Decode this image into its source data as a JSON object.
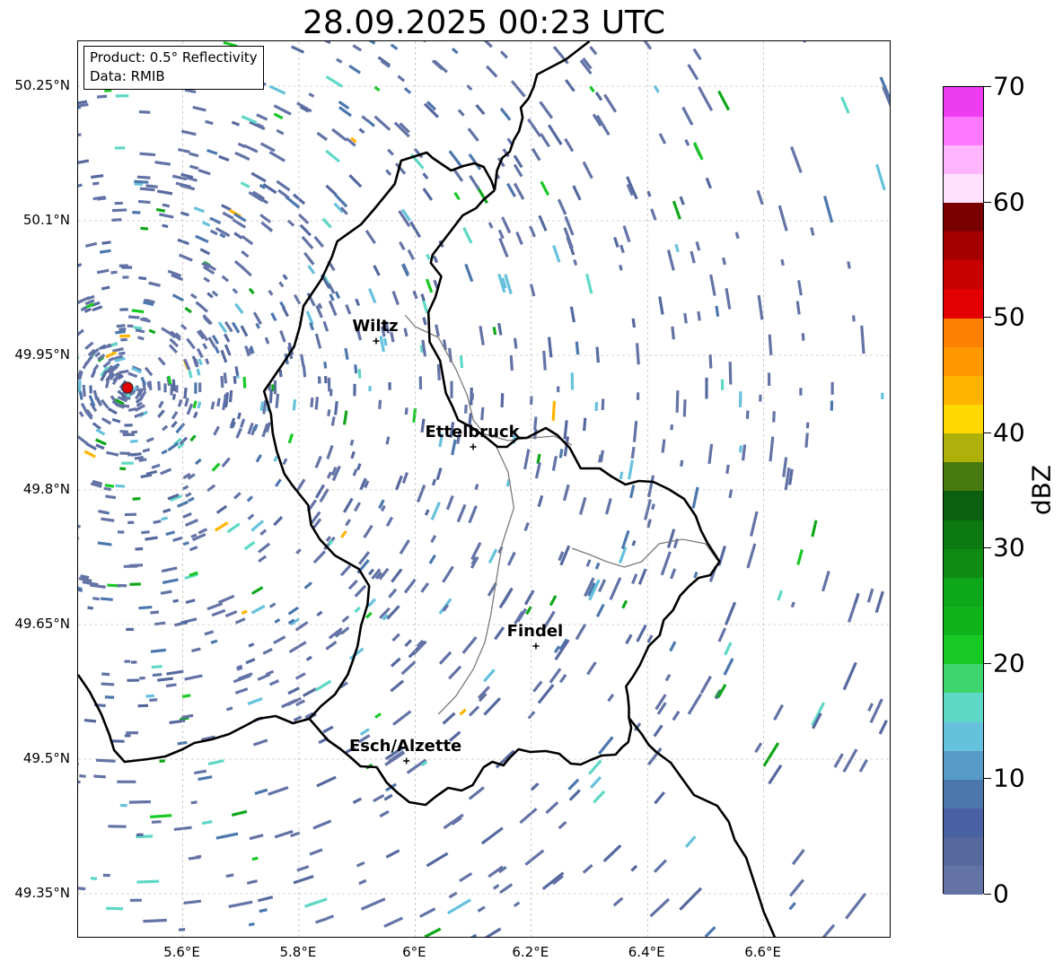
{
  "title": "28.09.2025 00:23 UTC",
  "info": {
    "product": "Product: 0.5° Reflectivity",
    "data": "Data: RMIB"
  },
  "map": {
    "lon_range": [
      5.42,
      6.82
    ],
    "lat_range": [
      49.3,
      50.3
    ],
    "lat_ticks": [
      {
        "value": 50.25,
        "label": "50.25°N"
      },
      {
        "value": 50.1,
        "label": "50.1°N"
      },
      {
        "value": 49.95,
        "label": "49.95°N"
      },
      {
        "value": 49.8,
        "label": "49.8°N"
      },
      {
        "value": 49.65,
        "label": "49.65°N"
      },
      {
        "value": 49.5,
        "label": "49.5°N"
      },
      {
        "value": 49.35,
        "label": "49.35°N"
      }
    ],
    "lon_ticks": [
      {
        "value": 5.6,
        "label": "5.6°E"
      },
      {
        "value": 5.8,
        "label": "5.8°E"
      },
      {
        "value": 6.0,
        "label": "6°E"
      },
      {
        "value": 6.2,
        "label": "6.2°E"
      },
      {
        "value": 6.4,
        "label": "6.4°E"
      },
      {
        "value": 6.6,
        "label": "6.6°E"
      }
    ],
    "radar_site": {
      "lon": 5.505,
      "lat": 49.914
    },
    "cities": [
      {
        "name": "Wiltz",
        "lon": 5.933,
        "lat": 49.966
      },
      {
        "name": "Ettelbruck",
        "lon": 6.1,
        "lat": 49.848
      },
      {
        "name": "Findel",
        "lon": 6.208,
        "lat": 49.626
      },
      {
        "name": "Esch/Alzette",
        "lon": 5.985,
        "lat": 49.498
      }
    ],
    "luxembourg_border": [
      [
        6.137,
        50.134
      ],
      [
        6.117,
        50.123
      ],
      [
        6.105,
        50.114
      ],
      [
        6.082,
        50.106
      ],
      [
        6.03,
        50.062
      ],
      [
        6.027,
        50.053
      ],
      [
        6.045,
        50.038
      ],
      [
        6.035,
        50.015
      ],
      [
        6.023,
        49.998
      ],
      [
        6.025,
        49.965
      ],
      [
        6.043,
        49.944
      ],
      [
        6.053,
        49.908
      ],
      [
        6.065,
        49.892
      ],
      [
        6.074,
        49.878
      ],
      [
        6.099,
        49.869
      ],
      [
        6.121,
        49.859
      ],
      [
        6.142,
        49.848
      ],
      [
        6.158,
        49.848
      ],
      [
        6.177,
        49.858
      ],
      [
        6.192,
        49.858
      ],
      [
        6.225,
        49.869
      ],
      [
        6.245,
        49.861
      ],
      [
        6.266,
        49.847
      ],
      [
        6.285,
        49.824
      ],
      [
        6.318,
        49.824
      ],
      [
        6.338,
        49.815
      ],
      [
        6.362,
        49.806
      ],
      [
        6.385,
        49.81
      ],
      [
        6.41,
        49.809
      ],
      [
        6.436,
        49.801
      ],
      [
        6.463,
        49.79
      ],
      [
        6.483,
        49.771
      ],
      [
        6.492,
        49.755
      ],
      [
        6.503,
        49.741
      ],
      [
        6.524,
        49.72
      ],
      [
        6.508,
        49.705
      ],
      [
        6.488,
        49.702
      ],
      [
        6.472,
        49.693
      ],
      [
        6.456,
        49.682
      ],
      [
        6.444,
        49.666
      ],
      [
        6.428,
        49.655
      ],
      [
        6.421,
        49.638
      ],
      [
        6.402,
        49.626
      ],
      [
        6.387,
        49.605
      ],
      [
        6.375,
        49.592
      ],
      [
        6.363,
        49.581
      ],
      [
        6.366,
        49.571
      ],
      [
        6.368,
        49.558
      ],
      [
        6.368,
        49.546
      ],
      [
        6.372,
        49.535
      ],
      [
        6.367,
        49.519
      ],
      [
        6.356,
        49.513
      ],
      [
        6.345,
        49.505
      ],
      [
        6.321,
        49.504
      ],
      [
        6.302,
        49.499
      ],
      [
        6.285,
        49.494
      ],
      [
        6.268,
        49.495
      ],
      [
        6.248,
        49.506
      ],
      [
        6.225,
        49.509
      ],
      [
        6.198,
        49.508
      ],
      [
        6.178,
        49.511
      ],
      [
        6.162,
        49.501
      ],
      [
        6.152,
        49.493
      ],
      [
        6.133,
        49.497
      ],
      [
        6.118,
        49.491
      ],
      [
        6.099,
        49.471
      ],
      [
        6.08,
        49.465
      ],
      [
        6.057,
        49.468
      ],
      [
        6.035,
        49.458
      ],
      [
        6.018,
        49.449
      ],
      [
        5.99,
        49.452
      ],
      [
        5.969,
        49.463
      ],
      [
        5.951,
        49.474
      ],
      [
        5.934,
        49.491
      ],
      [
        5.906,
        49.492
      ],
      [
        5.889,
        49.502
      ],
      [
        5.872,
        49.511
      ],
      [
        5.85,
        49.521
      ],
      [
        5.818,
        49.545
      ],
      [
        5.838,
        49.559
      ],
      [
        5.862,
        49.572
      ],
      [
        5.884,
        49.594
      ],
      [
        5.893,
        49.61
      ],
      [
        5.901,
        49.626
      ],
      [
        5.907,
        49.649
      ],
      [
        5.918,
        49.672
      ],
      [
        5.921,
        49.693
      ],
      [
        5.903,
        49.712
      ],
      [
        5.862,
        49.727
      ],
      [
        5.836,
        49.745
      ],
      [
        5.821,
        49.761
      ],
      [
        5.816,
        49.783
      ],
      [
        5.789,
        49.805
      ],
      [
        5.775,
        49.818
      ],
      [
        5.762,
        49.843
      ],
      [
        5.755,
        49.863
      ],
      [
        5.752,
        49.884
      ],
      [
        5.74,
        49.91
      ],
      [
        5.775,
        49.943
      ],
      [
        5.792,
        49.96
      ],
      [
        5.802,
        49.983
      ],
      [
        5.808,
        50.005
      ],
      [
        5.839,
        50.035
      ],
      [
        5.857,
        50.06
      ],
      [
        5.866,
        50.077
      ],
      [
        5.907,
        50.096
      ],
      [
        5.931,
        50.114
      ],
      [
        5.965,
        50.141
      ],
      [
        5.976,
        50.167
      ],
      [
        6.02,
        50.176
      ],
      [
        6.03,
        50.17
      ],
      [
        6.062,
        50.156
      ],
      [
        6.083,
        50.161
      ],
      [
        6.102,
        50.164
      ],
      [
        6.118,
        50.16
      ],
      [
        6.131,
        50.145
      ],
      [
        6.137,
        50.134
      ]
    ],
    "country_border_east": [
      [
        6.137,
        50.134
      ],
      [
        6.141,
        50.156
      ],
      [
        6.15,
        50.17
      ],
      [
        6.163,
        50.177
      ],
      [
        6.17,
        50.19
      ],
      [
        6.179,
        50.2
      ],
      [
        6.185,
        50.215
      ],
      [
        6.182,
        50.226
      ],
      [
        6.195,
        50.236
      ],
      [
        6.204,
        50.249
      ],
      [
        6.21,
        50.263
      ],
      [
        6.26,
        50.28
      ],
      [
        6.3,
        50.3
      ]
    ],
    "country_border_south": [
      [
        6.368,
        49.546
      ],
      [
        6.39,
        49.528
      ],
      [
        6.402,
        49.516
      ],
      [
        6.415,
        49.508
      ],
      [
        6.44,
        49.496
      ],
      [
        6.46,
        49.478
      ],
      [
        6.48,
        49.46
      ],
      [
        6.52,
        49.448
      ],
      [
        6.54,
        49.43
      ],
      [
        6.55,
        49.41
      ],
      [
        6.57,
        49.39
      ],
      [
        6.58,
        49.37
      ],
      [
        6.59,
        49.35
      ],
      [
        6.6,
        49.33
      ],
      [
        6.62,
        49.3
      ]
    ],
    "country_border_west": [
      [
        5.818,
        49.545
      ],
      [
        5.79,
        49.54
      ],
      [
        5.76,
        49.548
      ],
      [
        5.73,
        49.545
      ],
      [
        5.71,
        49.538
      ],
      [
        5.68,
        49.528
      ],
      [
        5.65,
        49.522
      ],
      [
        5.62,
        49.518
      ],
      [
        5.6,
        49.511
      ],
      [
        5.57,
        49.503
      ],
      [
        5.54,
        49.5
      ],
      [
        5.5,
        49.497
      ],
      [
        5.482,
        49.51
      ],
      [
        5.474,
        49.527
      ],
      [
        5.46,
        49.55
      ],
      [
        5.44,
        49.575
      ],
      [
        5.42,
        49.594
      ]
    ],
    "sure_river": [
      [
        5.983,
        49.995
      ],
      [
        6.0,
        49.982
      ],
      [
        6.04,
        49.97
      ],
      [
        6.07,
        49.935
      ],
      [
        6.09,
        49.905
      ],
      [
        6.1,
        49.878
      ],
      [
        6.12,
        49.862
      ],
      [
        6.16,
        49.855
      ],
      [
        6.2,
        49.858
      ],
      [
        6.24,
        49.86
      ],
      [
        6.27,
        49.85
      ]
    ],
    "moselle_river": [
      [
        6.27,
        49.735
      ],
      [
        6.3,
        49.728
      ],
      [
        6.33,
        49.72
      ],
      [
        6.36,
        49.714
      ],
      [
        6.39,
        49.72
      ],
      [
        6.42,
        49.74
      ],
      [
        6.46,
        49.745
      ],
      [
        6.5,
        49.74
      ],
      [
        6.52,
        49.722
      ]
    ],
    "alzette_river": [
      [
        6.04,
        49.55
      ],
      [
        6.07,
        49.57
      ],
      [
        6.1,
        49.6
      ],
      [
        6.12,
        49.63
      ],
      [
        6.13,
        49.66
      ],
      [
        6.14,
        49.7
      ],
      [
        6.15,
        49.74
      ],
      [
        6.17,
        49.78
      ],
      [
        6.16,
        49.82
      ],
      [
        6.14,
        49.848
      ]
    ]
  },
  "colorbar": {
    "label": "dBZ",
    "min": 0,
    "max": 70,
    "ticks": [
      {
        "value": 0,
        "label": "0"
      },
      {
        "value": 10,
        "label": "10"
      },
      {
        "value": 20,
        "label": "20"
      },
      {
        "value": 30,
        "label": "30"
      },
      {
        "value": 40,
        "label": "40"
      },
      {
        "value": 50,
        "label": "50"
      },
      {
        "value": 60,
        "label": "60"
      },
      {
        "value": 70,
        "label": "70"
      }
    ],
    "colors": [
      "#6473a6",
      "#56699f",
      "#4960a3",
      "#4c77ad",
      "#579cc6",
      "#65c1dc",
      "#5ed8c6",
      "#3ed46e",
      "#18c825",
      "#10b41a",
      "#0fa71a",
      "#0e8c12",
      "#0c7a11",
      "#0b5f0e",
      "#487a10",
      "#b0b00a",
      "#ffd800",
      "#ffb400",
      "#ff9800",
      "#ff8000",
      "#e30000",
      "#c80000",
      "#a70000",
      "#7a0000",
      "#ffe1ff",
      "#ffb6ff",
      "#ff78ff",
      "#ee3cf0"
    ]
  }
}
